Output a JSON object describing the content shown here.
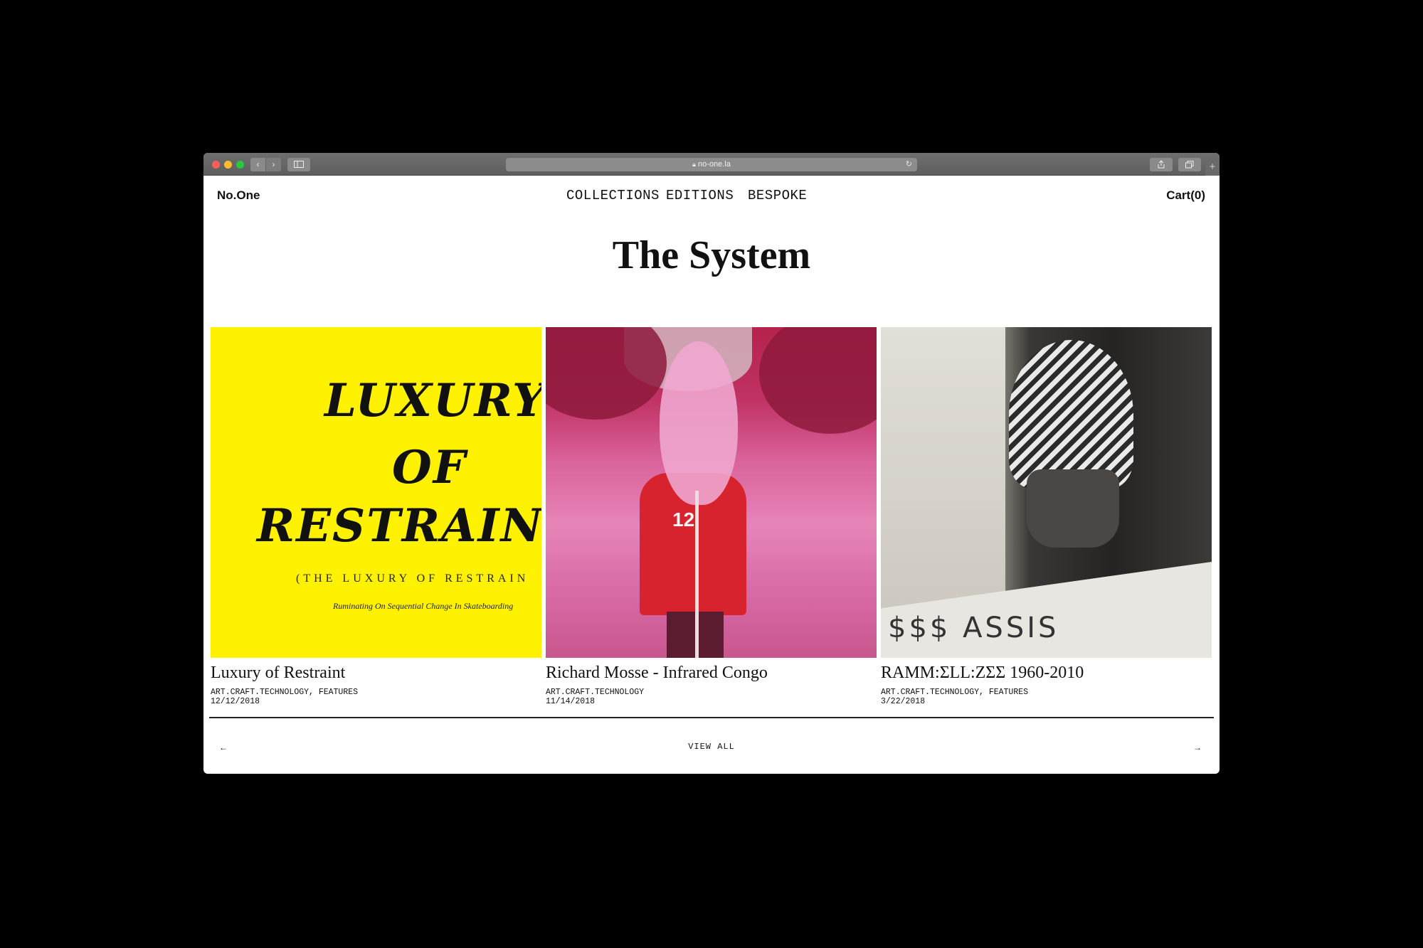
{
  "browser": {
    "url": "no-one.la",
    "lock_icon": "lock-icon",
    "back_glyph": "‹",
    "forward_glyph": "›",
    "newtab_glyph": "+"
  },
  "header": {
    "logo": "No.One",
    "nav": [
      "COLLECTIONS",
      "EDITIONS",
      "BESPOKE"
    ],
    "cart": "Cart(0)"
  },
  "page": {
    "title": "The System"
  },
  "cards": [
    {
      "title": "Luxury of Restraint",
      "tags": "ART.CRAFT.TECHNOLOGY, FEATURES",
      "date": "12/12/2018",
      "image": {
        "line1": "LUXURY",
        "line2": "OF",
        "line3": "RESTRAINT",
        "subtitle": "(THE LUXURY OF RESTRAIN",
        "tagline": "Ruminating On Sequential Change In Skateboarding"
      }
    },
    {
      "title": "Richard Mosse - Infrared Congo",
      "tags": "ART.CRAFT.TECHNOLOGY",
      "date": "11/14/2018",
      "image": {
        "jersey_number": "12"
      }
    },
    {
      "title": "RAMM:ΣLL:ΖΣΣ 1960-2010",
      "tags": "ART.CRAFT.TECHNOLOGY, FEATURES",
      "date": "3/22/2018",
      "image": {
        "scrawl": "$$$ ASSIS"
      }
    }
  ],
  "pager": {
    "prev": "←",
    "view_all": "VIEW ALL",
    "next": "→"
  },
  "colors": {
    "yellow_thumb": "#fff200",
    "text": "#111111"
  }
}
